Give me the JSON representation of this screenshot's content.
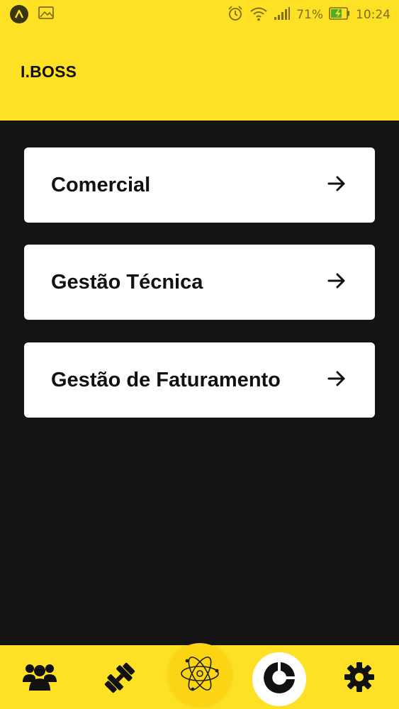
{
  "status_bar": {
    "battery_percent": "71%",
    "time": "10:24"
  },
  "header": {
    "title": "I.BOSS"
  },
  "menu": {
    "items": [
      {
        "label": "Comercial"
      },
      {
        "label": "Gestão Técnica"
      },
      {
        "label": "Gestão de Faturamento"
      }
    ]
  },
  "bottom_nav": {
    "items": [
      {
        "icon": "users-icon"
      },
      {
        "icon": "dumbbell-icon"
      },
      {
        "icon": "atom-icon"
      },
      {
        "icon": "donut-chart-icon",
        "active": true
      },
      {
        "icon": "gear-icon"
      }
    ]
  },
  "colors": {
    "brand_yellow": "#FEE024",
    "background": "#141414",
    "card": "#FFFFFF",
    "text": "#111111"
  }
}
